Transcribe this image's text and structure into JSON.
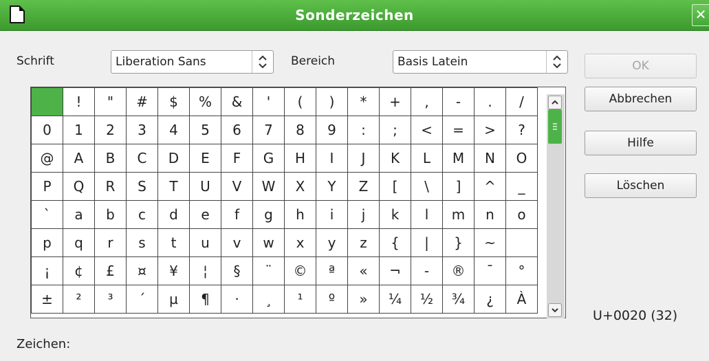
{
  "window": {
    "title": "Sonderzeichen"
  },
  "font_label": "Schrift",
  "font_value": "Liberation Sans",
  "range_label": "Bereich",
  "range_value": "Basis Latein",
  "buttons": {
    "ok": "OK",
    "cancel": "Abbrechen",
    "help": "Hilfe",
    "delete": "Löschen"
  },
  "grid": {
    "rows": [
      [
        " ",
        "!",
        "\"",
        "#",
        "$",
        "%",
        "&",
        "'",
        "(",
        ")",
        "*",
        "+",
        ",",
        "-",
        ".",
        "/"
      ],
      [
        "0",
        "1",
        "2",
        "3",
        "4",
        "5",
        "6",
        "7",
        "8",
        "9",
        ":",
        ";",
        "<",
        "=",
        ">",
        "?"
      ],
      [
        "@",
        "A",
        "B",
        "C",
        "D",
        "E",
        "F",
        "G",
        "H",
        "I",
        "J",
        "K",
        "L",
        "M",
        "N",
        "O"
      ],
      [
        "P",
        "Q",
        "R",
        "S",
        "T",
        "U",
        "V",
        "W",
        "X",
        "Y",
        "Z",
        "[",
        "\\",
        "]",
        "^",
        "_"
      ],
      [
        "`",
        "a",
        "b",
        "c",
        "d",
        "e",
        "f",
        "g",
        "h",
        "i",
        "j",
        "k",
        "l",
        "m",
        "n",
        "o"
      ],
      [
        "p",
        "q",
        "r",
        "s",
        "t",
        "u",
        "v",
        "w",
        "x",
        "y",
        "z",
        "{",
        "|",
        "}",
        "~",
        ""
      ],
      [
        "¡",
        "¢",
        "£",
        "¤",
        "¥",
        "¦",
        "§",
        "¨",
        "©",
        "ª",
        "«",
        "¬",
        "-",
        "®",
        "¯",
        "°"
      ],
      [
        "±",
        "²",
        "³",
        "´",
        "µ",
        "¶",
        "·",
        "¸",
        "¹",
        "º",
        "»",
        "¼",
        "½",
        "¾",
        "¿",
        "À"
      ]
    ]
  },
  "selected_code": "U+0020 (32)",
  "char_label": "Zeichen:",
  "colors": {
    "accent": "#4db348",
    "titlebar": "#46a838"
  }
}
